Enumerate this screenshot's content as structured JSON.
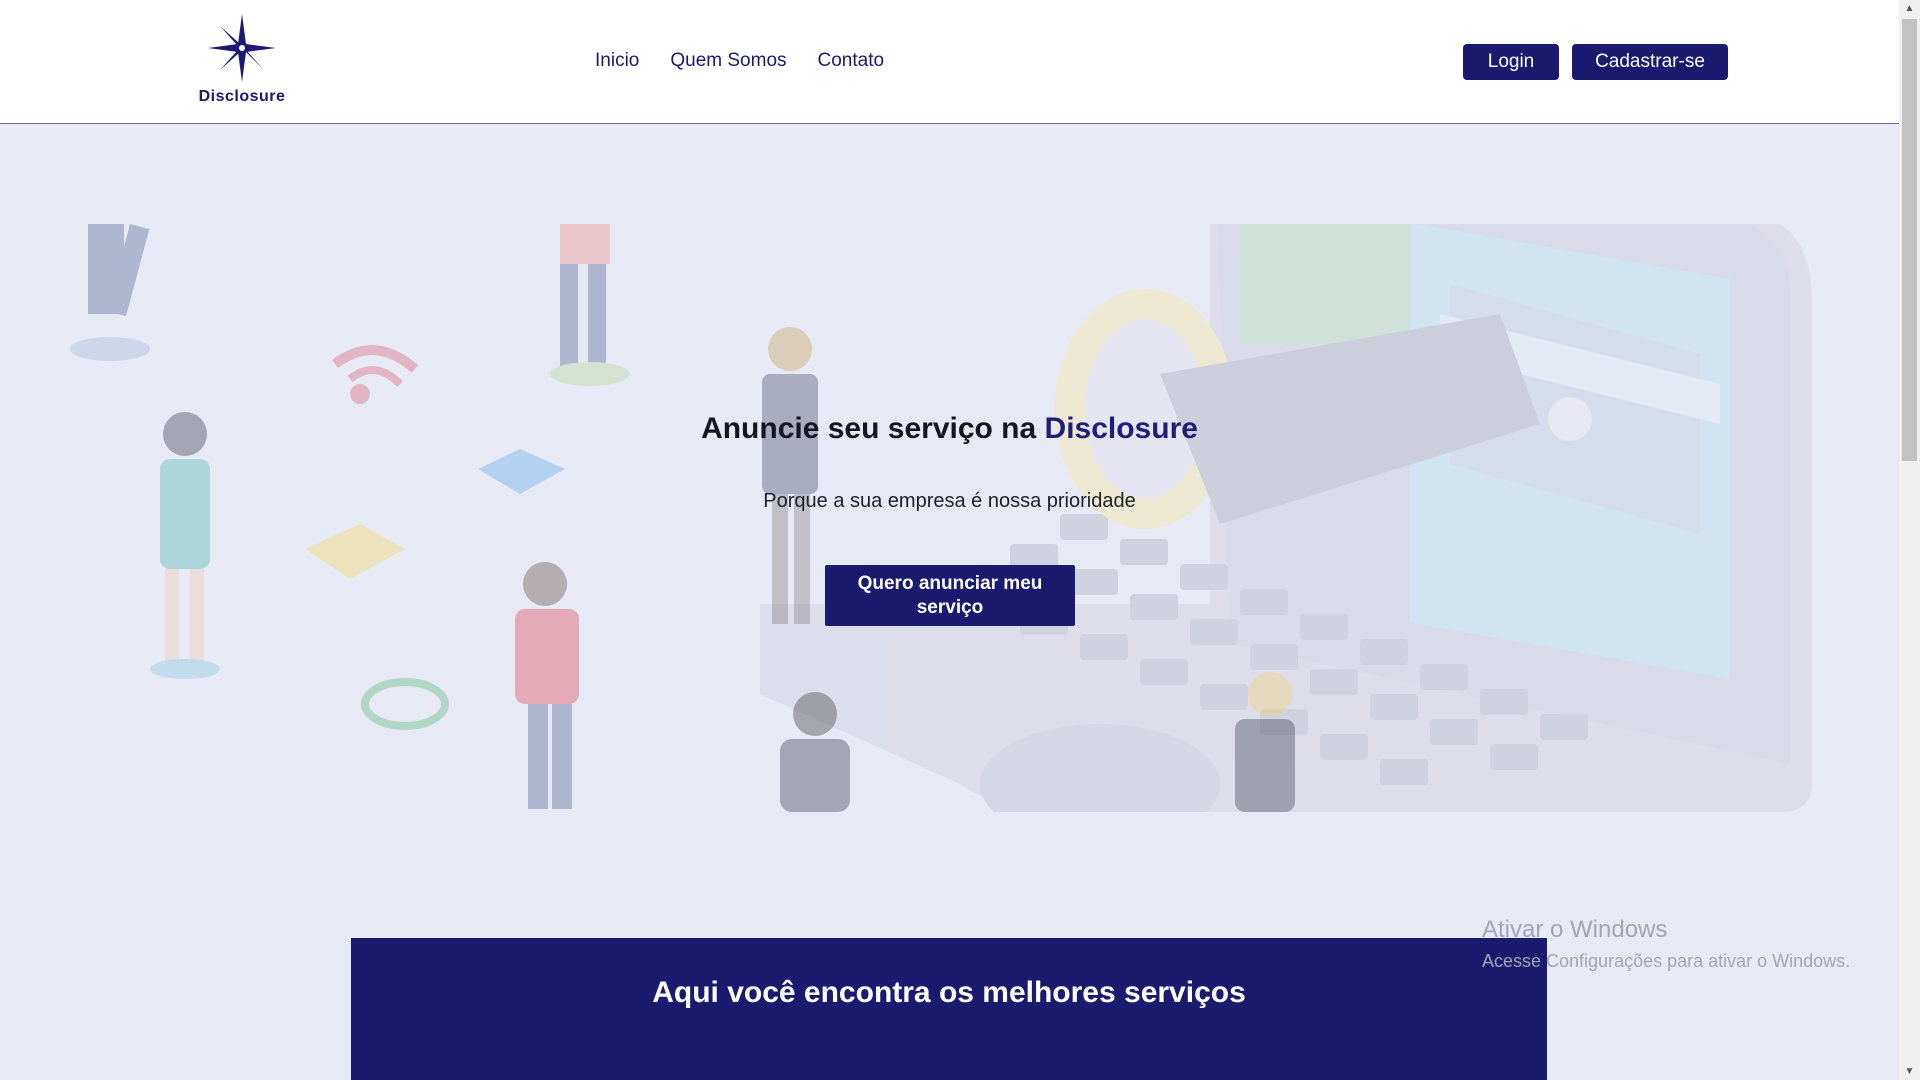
{
  "header": {
    "logo_text": "Disclosure",
    "nav": [
      "Inicio",
      "Quem Somos",
      "Contato"
    ],
    "login_label": "Login",
    "signup_label": "Cadastrar-se"
  },
  "hero": {
    "title_prefix": "Anuncie seu serviço na ",
    "title_brand": "Disclosure",
    "subtitle": "Porque a sua empresa é nossa prioridade",
    "cta_label": "Quero anunciar meu serviço"
  },
  "services": {
    "title": "Aqui você encontra os melhores serviços"
  },
  "windows_watermark": {
    "title": "Ativar o Windows",
    "subtitle": "Acesse Configurações para ativar o Windows."
  },
  "colors": {
    "primary": "#1a1a6e",
    "background": "#e7e9f5",
    "header_bg": "#ffffff"
  },
  "icons": [
    "compass-star-icon",
    "scroll-up-arrow-icon",
    "scroll-down-arrow-icon"
  ]
}
